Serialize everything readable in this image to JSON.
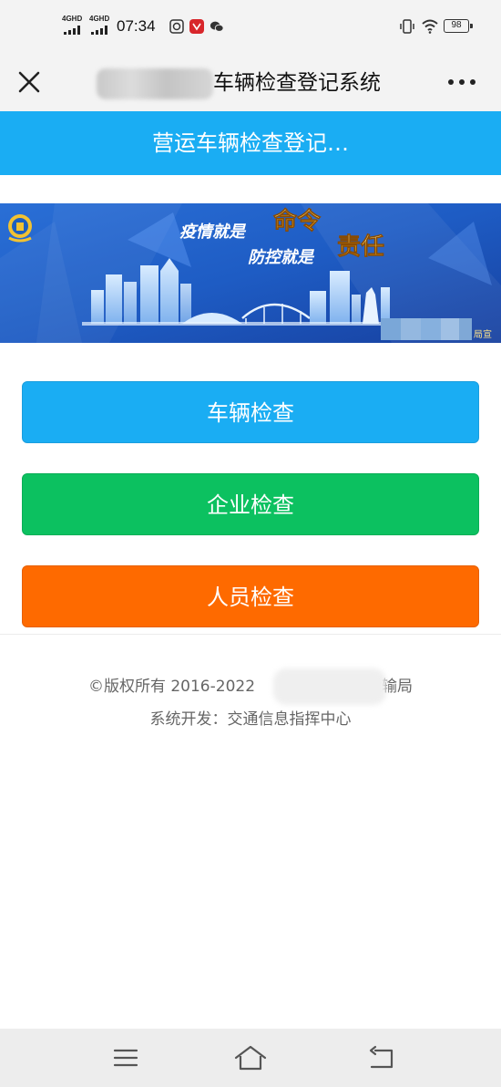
{
  "status_bar": {
    "network1": "4GHD",
    "network2": "4GHD",
    "time": "07:34",
    "battery": "98"
  },
  "title_bar": {
    "title_visible": "车辆检查登记系统"
  },
  "header": {
    "title": "营运车辆检查登记…"
  },
  "banner": {
    "line1_prefix": "疫情就是",
    "line1_highlight": "命令",
    "line2_prefix": "防控就是",
    "line2_highlight": "责任",
    "corner_text": "局宣"
  },
  "buttons": {
    "vehicle_check": "车辆检查",
    "company_check": "企业检查",
    "staff_check": "人员检查"
  },
  "footer": {
    "copyright": "©版权所有 2016-2022",
    "copyright_suffix": "运输局",
    "developer": "系统开发：交通信息指挥中心"
  },
  "colors": {
    "header_blue": "#1aadf3",
    "green": "#0cc160",
    "orange": "#fe6a00"
  }
}
